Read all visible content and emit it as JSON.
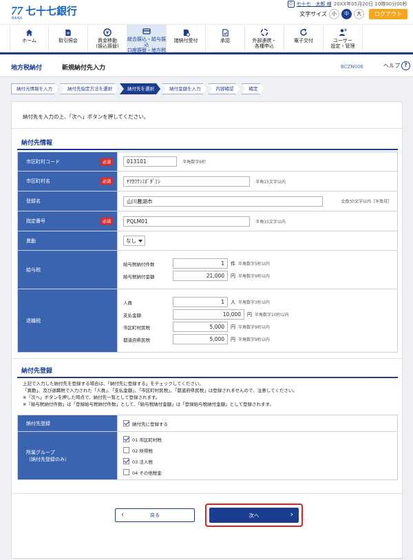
{
  "header": {
    "logo_mark": "77",
    "logo_bank": "BANK",
    "bank_name": "七十七銀行",
    "user_name": "七十七　太郎 様",
    "datetime": "20XX年05月20日 10時00分00秒",
    "fontsize_label": "文字サイズ",
    "fontsize_small": "小",
    "fontsize_medium": "中",
    "fontsize_large": "大",
    "logout_label": "ログアウト"
  },
  "nav": [
    {
      "label": "ホーム",
      "icon": "home-icon"
    },
    {
      "label": "取引照会",
      "icon": "document-icon"
    },
    {
      "label": "資金移動\n(振込振替)",
      "icon": "yen-transfer-icon"
    },
    {
      "label": "総合振込・給与振込\n口座振替・地方税",
      "icon": "card-icon"
    },
    {
      "label": "諸納付受付",
      "icon": "payment-icon"
    },
    {
      "label": "承認",
      "icon": "approve-icon"
    },
    {
      "label": "外部連携・\n各種申込",
      "icon": "link-icon"
    },
    {
      "label": "電子交付",
      "icon": "refresh-icon"
    },
    {
      "label": "ユーザー\n設定・管理",
      "icon": "user-settings-icon"
    }
  ],
  "titlebar": {
    "section": "地方税納付",
    "page": "新規納付先入力",
    "code": "BCZN006",
    "help": "ヘルプ"
  },
  "steps": [
    "納付元情報を入力",
    "納付先指定方法を選択",
    "納付先を選択",
    "納付金額を入力",
    "内容確認",
    "確定"
  ],
  "instruction": "納付先を入力の上、「次へ」ボタンを押してください。",
  "payee_info": {
    "title": "納付先情報",
    "required_label": "必須",
    "city_code_label": "市区町村コード",
    "city_code_value": "013101",
    "city_code_hint": "半角数字6桁",
    "city_name_label": "市区町村名",
    "city_name_value": "ﾔﾏｶﾜｸﾝﾐﾇﾞﾀﾞﾐｼ",
    "city_name_hint": "半角15文字以内",
    "reg_name_label": "登録名",
    "reg_name_value": "山川農湖市",
    "reg_name_hint": "全角30文字以内［半角可］",
    "designation_label": "指定番号",
    "designation_value": "PQLM01",
    "designation_hint": "半角15文字以内",
    "transfer_label": "異動",
    "transfer_value": "なし",
    "salary_tax_label": "給与税",
    "salary_count_label": "給与税納付件数",
    "salary_count_value": "1",
    "salary_count_unit": "件",
    "salary_count_hint": "半角数字5桁以内",
    "salary_amount_label": "給与税納付金額",
    "salary_amount_value": "21,000",
    "salary_amount_unit": "円",
    "salary_amount_hint": "半角数字9桁以内",
    "retire_tax_label": "退職税",
    "people_label": "人員",
    "people_value": "1",
    "people_unit": "人",
    "people_hint": "半角数字3桁以内",
    "paid_label": "支払金額",
    "paid_value": "10,000",
    "paid_unit": "円",
    "paid_hint": "半角数字10桁以内",
    "city_tax_label": "市区町村民税",
    "city_tax_value": "5,000",
    "city_tax_unit": "円",
    "city_tax_hint": "半角数字9桁以内",
    "pref_tax_label": "都道府県民税",
    "pref_tax_value": "5,000",
    "pref_tax_unit": "円",
    "pref_tax_hint": "半角数字9桁以内"
  },
  "registration": {
    "title": "納付先登録",
    "note1": "上記で入力した納付先を登録する場合は、「納付先に登録する」をチェックしてください。",
    "note2": "「異動」、及び退職税で入力された「人員」、「支払金額」、「市区町村民税」、「都道府県民税」は登録されませんので、注意してください。",
    "note3": "※「次へ」ボタンを押した時点で、納付先一覧として登録されます。",
    "note4": "※「給与税納付件数」は「登録給与税納付件数」として、「給与税納付金額」は「登録給与税納付金額」として登録されます。",
    "register_label": "納付先登録",
    "register_check": "納付先に登録する",
    "group_label": "所属グループ",
    "group_sub": "（納付先登録のみ）",
    "groups": [
      {
        "label": "01 市区町村税",
        "checked": true
      },
      {
        "label": "02 所得税",
        "checked": false
      },
      {
        "label": "03 法人税",
        "checked": true
      },
      {
        "label": "04 その他税金",
        "checked": false
      }
    ]
  },
  "buttons": {
    "back": "戻る",
    "next": "次へ"
  }
}
